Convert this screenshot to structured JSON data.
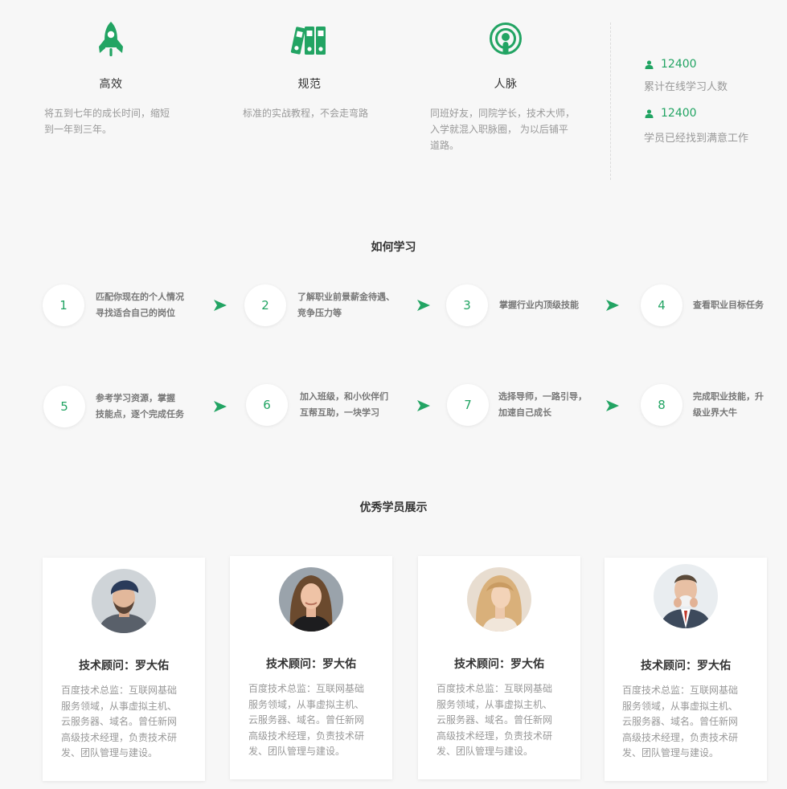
{
  "features": [
    {
      "icon": "rocket-icon",
      "title": "高效",
      "desc": [
        "将五到七年的成长时间，缩短",
        "到一年到三年。"
      ]
    },
    {
      "icon": "binders-icon",
      "title": "规范",
      "desc": [
        "标准的实战教程，不会走弯路"
      ]
    },
    {
      "icon": "podcast-icon",
      "title": "人脉",
      "desc": [
        "同班好友，同院学长，技术大师，",
        "入学就混入职脉圈，  为以后铺平",
        "道路。"
      ]
    }
  ],
  "stats": [
    {
      "icon": "user-icon",
      "value": "12400",
      "label": "累计在线学习人数"
    },
    {
      "icon": "user-icon",
      "value": "12400",
      "label": "学员已经找到满意工作"
    }
  ],
  "how_to_learn": {
    "title": "如何学习",
    "steps": [
      {
        "num": "1",
        "text": [
          "匹配你现在的个人情况",
          "寻找适合自己的岗位"
        ]
      },
      {
        "num": "2",
        "text": [
          "了解职业前景薪金待遇、",
          "竞争压力等"
        ]
      },
      {
        "num": "3",
        "text": [
          "掌握行业内顶级技能"
        ]
      },
      {
        "num": "4",
        "text": [
          "查看职业目标任务"
        ]
      },
      {
        "num": "5",
        "text": [
          "参考学习资源，掌握",
          "技能点，逐个完成任务"
        ]
      },
      {
        "num": "6",
        "text": [
          "加入班级，和小伙伴们",
          "互帮互助，一块学习"
        ]
      },
      {
        "num": "7",
        "text": [
          "选择导师，一路引导，",
          "加速自己成长"
        ]
      },
      {
        "num": "8",
        "text": [
          "完成职业技能，升",
          "级业界大牛"
        ]
      }
    ]
  },
  "students": {
    "title": "优秀学员展示",
    "cards": [
      {
        "avatar": "avatar-man-beanie",
        "title": "技术顾问：罗大佑",
        "desc": [
          "百度技术总监：互联网基础",
          "服务领域，从事虚拟主机、",
          "云服务器、域名。曾任新网",
          "高级技术经理，负责技术研",
          "发、团队管理与建设。"
        ]
      },
      {
        "avatar": "avatar-woman-brunette",
        "title": "技术顾问：罗大佑",
        "desc": [
          "百度技术总监：互联网基础",
          "服务领域，从事虚拟主机、",
          "云服务器、域名。曾任新网",
          "高级技术经理，负责技术研",
          "发、团队管理与建设。"
        ]
      },
      {
        "avatar": "avatar-woman-blonde",
        "title": "技术顾问：罗大佑",
        "desc": [
          "百度技术总监：互联网基础",
          "服务领域，从事虚拟主机、",
          "云服务器、域名。曾任新网",
          "高级技术经理，负责技术研",
          "发、团队管理与建设。"
        ]
      },
      {
        "avatar": "avatar-man-suit",
        "title": "技术顾问：罗大佑",
        "desc": [
          "百度技术总监：互联网基础",
          "服务领域，从事虚拟主机、",
          "云服务器、域名。曾任新网",
          "高级技术经理，负责技术研",
          "发、团队管理与建设。"
        ]
      }
    ]
  },
  "colors": {
    "accent": "#22a463",
    "muted": "#999999",
    "background": "#f7f7f7"
  }
}
